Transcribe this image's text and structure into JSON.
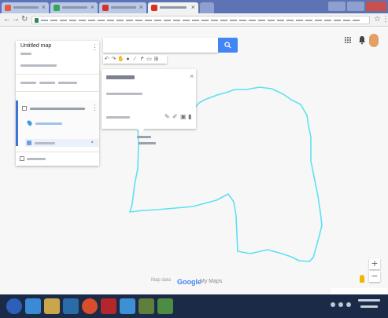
{
  "app": {
    "title": "Untitled map"
  },
  "map": {
    "google_logo": "Google",
    "mymaps_logo": "My Maps",
    "map_data": "Map data"
  },
  "icons": {
    "search": "search-icon",
    "apps": "apps-grid-icon",
    "notifications": "notifications-icon",
    "zoom_in": "plus-icon",
    "zoom_out": "minus-icon",
    "street_view": "pegman-icon"
  },
  "colors": {
    "accent": "#4285f4",
    "route": "#5fe0f2",
    "tab_strip": "#5d73b3",
    "taskbar": "#1b2a47"
  },
  "zoom": {
    "in": "+",
    "out": "−"
  }
}
